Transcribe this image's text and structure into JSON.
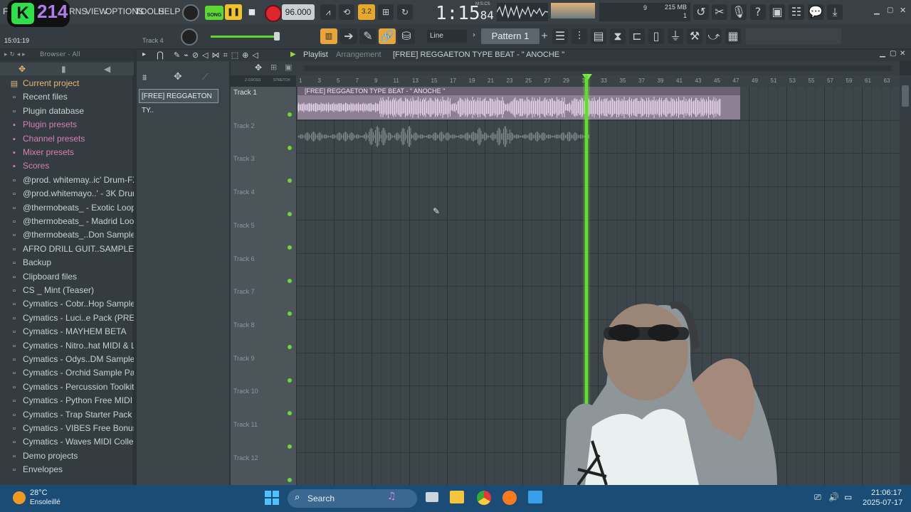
{
  "app": {
    "logo_letter": "K",
    "logo_number": "214",
    "menu": [
      "F",
      "RNS",
      "VIEW",
      "OPTIONS",
      "TOOLS",
      "HELP"
    ]
  },
  "toolbar": {
    "song_mode": "SONG",
    "tempo": "96.000",
    "time": "1:15",
    "time_small": "84",
    "time_label": "M:S:CS",
    "counter": "9",
    "memory": "215 MB",
    "mem_sub": "1",
    "snap_value": "3.2",
    "hint_time": "15:01:19",
    "hint_track": "Track 4",
    "line_mode": "Line",
    "pattern": "Pattern 1"
  },
  "browser": {
    "title": "Browser - All",
    "items": [
      {
        "label": "Current project",
        "kind": "top"
      },
      {
        "label": "Recent files",
        "kind": "plain"
      },
      {
        "label": "Plugin database",
        "kind": "plain"
      },
      {
        "label": "Plugin presets",
        "kind": "cat"
      },
      {
        "label": "Channel presets",
        "kind": "cat"
      },
      {
        "label": "Mixer presets",
        "kind": "cat"
      },
      {
        "label": "Scores",
        "kind": "cat"
      },
      {
        "label": "@prod. whitemay..ic' Drum-FX Kit",
        "kind": "plain"
      },
      {
        "label": "@prod.whitemayo..' - 3K Drum Kit",
        "kind": "plain"
      },
      {
        "label": "@thermobeats_ - Exotic Loopkit",
        "kind": "plain"
      },
      {
        "label": "@thermobeats_ - Madrid Loop Kit",
        "kind": "plain"
      },
      {
        "label": "@thermobeats_..Don Sample Pack",
        "kind": "plain"
      },
      {
        "label": "AFRO DRILL GUIT..SAMPLES VOL. 1",
        "kind": "plain"
      },
      {
        "label": "Backup",
        "kind": "plain"
      },
      {
        "label": "Clipboard files",
        "kind": "plain"
      },
      {
        "label": "CS _ Mint (Teaser)",
        "kind": "plain"
      },
      {
        "label": "Cymatics - Cobr..Hop Sample Pack",
        "kind": "plain"
      },
      {
        "label": "Cymatics - Luci..e Pack (PREVIEW)",
        "kind": "plain"
      },
      {
        "label": "Cymatics - MAYHEM BETA",
        "kind": "plain"
      },
      {
        "label": "Cymatics - Nitro..hat MIDI & Loops",
        "kind": "plain"
      },
      {
        "label": "Cymatics - Odys..DM Sample Pack",
        "kind": "plain"
      },
      {
        "label": "Cymatics - Orchid Sample Pack",
        "kind": "plain"
      },
      {
        "label": "Cymatics - Percussion Toolkit Vol 1",
        "kind": "plain"
      },
      {
        "label": "Cymatics - Python Free MIDI Pack",
        "kind": "plain"
      },
      {
        "label": "Cymatics - Trap Starter Pack",
        "kind": "plain"
      },
      {
        "label": "Cymatics - VIBES Free Bonus Pack",
        "kind": "plain"
      },
      {
        "label": "Cymatics - Waves MIDI Collection",
        "kind": "plain"
      },
      {
        "label": "Demo projects",
        "kind": "plain"
      },
      {
        "label": "Envelopes",
        "kind": "plain"
      }
    ]
  },
  "picker": {
    "clip_label": "[FREE] REGGAETON TY.."
  },
  "playlist": {
    "title": "Playlist",
    "subtitle": "Arrangement",
    "project": "[FREE] REGGAETON TYPE BEAT -  \" ANOCHE \"",
    "zcross": "Z-CROSS",
    "stretch": "STRETCH",
    "ruler_ticks": [
      "1",
      "3",
      "5",
      "7",
      "9",
      "11",
      "13",
      "15",
      "17",
      "19",
      "21",
      "23",
      "25",
      "27",
      "29",
      "31",
      "33",
      "35",
      "37",
      "39",
      "41",
      "43",
      "45",
      "47",
      "49",
      "51",
      "53",
      "55",
      "57",
      "59",
      "61",
      "63"
    ],
    "tracks": [
      "Track 1",
      "Track 2",
      "Track 3",
      "Track 4",
      "Track 5",
      "Track 6",
      "Track 7",
      "Track 8",
      "Track 9",
      "Track 10",
      "Track 11",
      "Track 12"
    ],
    "clip_name": "[FREE] REGGAETON TYPE BEAT -  \" ANOCHE \""
  },
  "taskbar": {
    "weather_temp": "28°C",
    "weather_desc": "Ensoleillé",
    "search": "Search",
    "clock_time": "21:06:17",
    "clock_date": "2025-07-17"
  },
  "colors": {
    "accent_green": "#5fe02a",
    "clip_purple": "#8d7f94",
    "taskbar": "#1a4c76"
  }
}
